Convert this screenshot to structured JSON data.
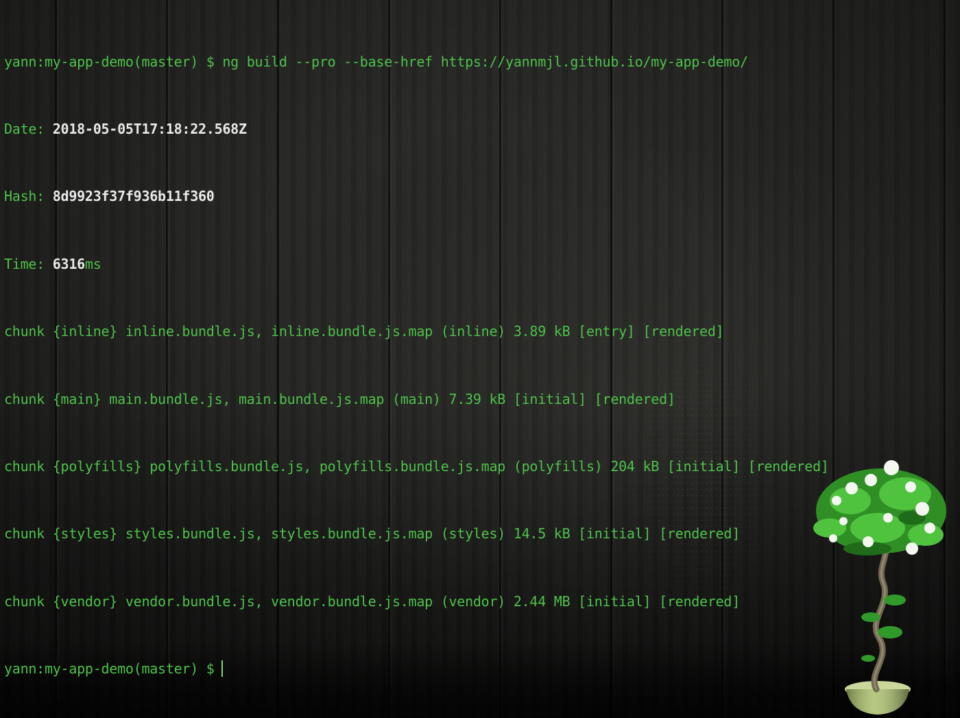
{
  "terminal": {
    "prompt": "yann:my-app-demo(master) $ ",
    "command": "ng build --pro --base-href https://yannmjl.github.io/my-app-demo/",
    "date_label": "Date: ",
    "date_value": "2018-05-05T17:18:22.568Z",
    "hash_label": "Hash: ",
    "hash_value": "8d9923f37f936b11f360",
    "time_label": "Time: ",
    "time_value": "6316",
    "time_unit": "ms",
    "chunks": [
      "chunk {inline} inline.bundle.js, inline.bundle.js.map (inline) 3.89 kB [entry] [rendered]",
      "chunk {main} main.bundle.js, main.bundle.js.map (main) 7.39 kB [initial] [rendered]",
      "chunk {polyfills} polyfills.bundle.js, polyfills.bundle.js.map (polyfills) 204 kB [initial] [rendered]",
      "chunk {styles} styles.bundle.js, styles.bundle.js.map (styles) 14.5 kB [initial] [rendered]",
      "chunk {vendor} vendor.bundle.js, vendor.bundle.js.map (vendor) 2.44 MB [initial] [rendered]"
    ],
    "final_prompt": "yann:my-app-demo(master) $"
  },
  "colors": {
    "text_green": "#4ec24a",
    "text_white": "#eaeaea",
    "background": "#242422"
  }
}
